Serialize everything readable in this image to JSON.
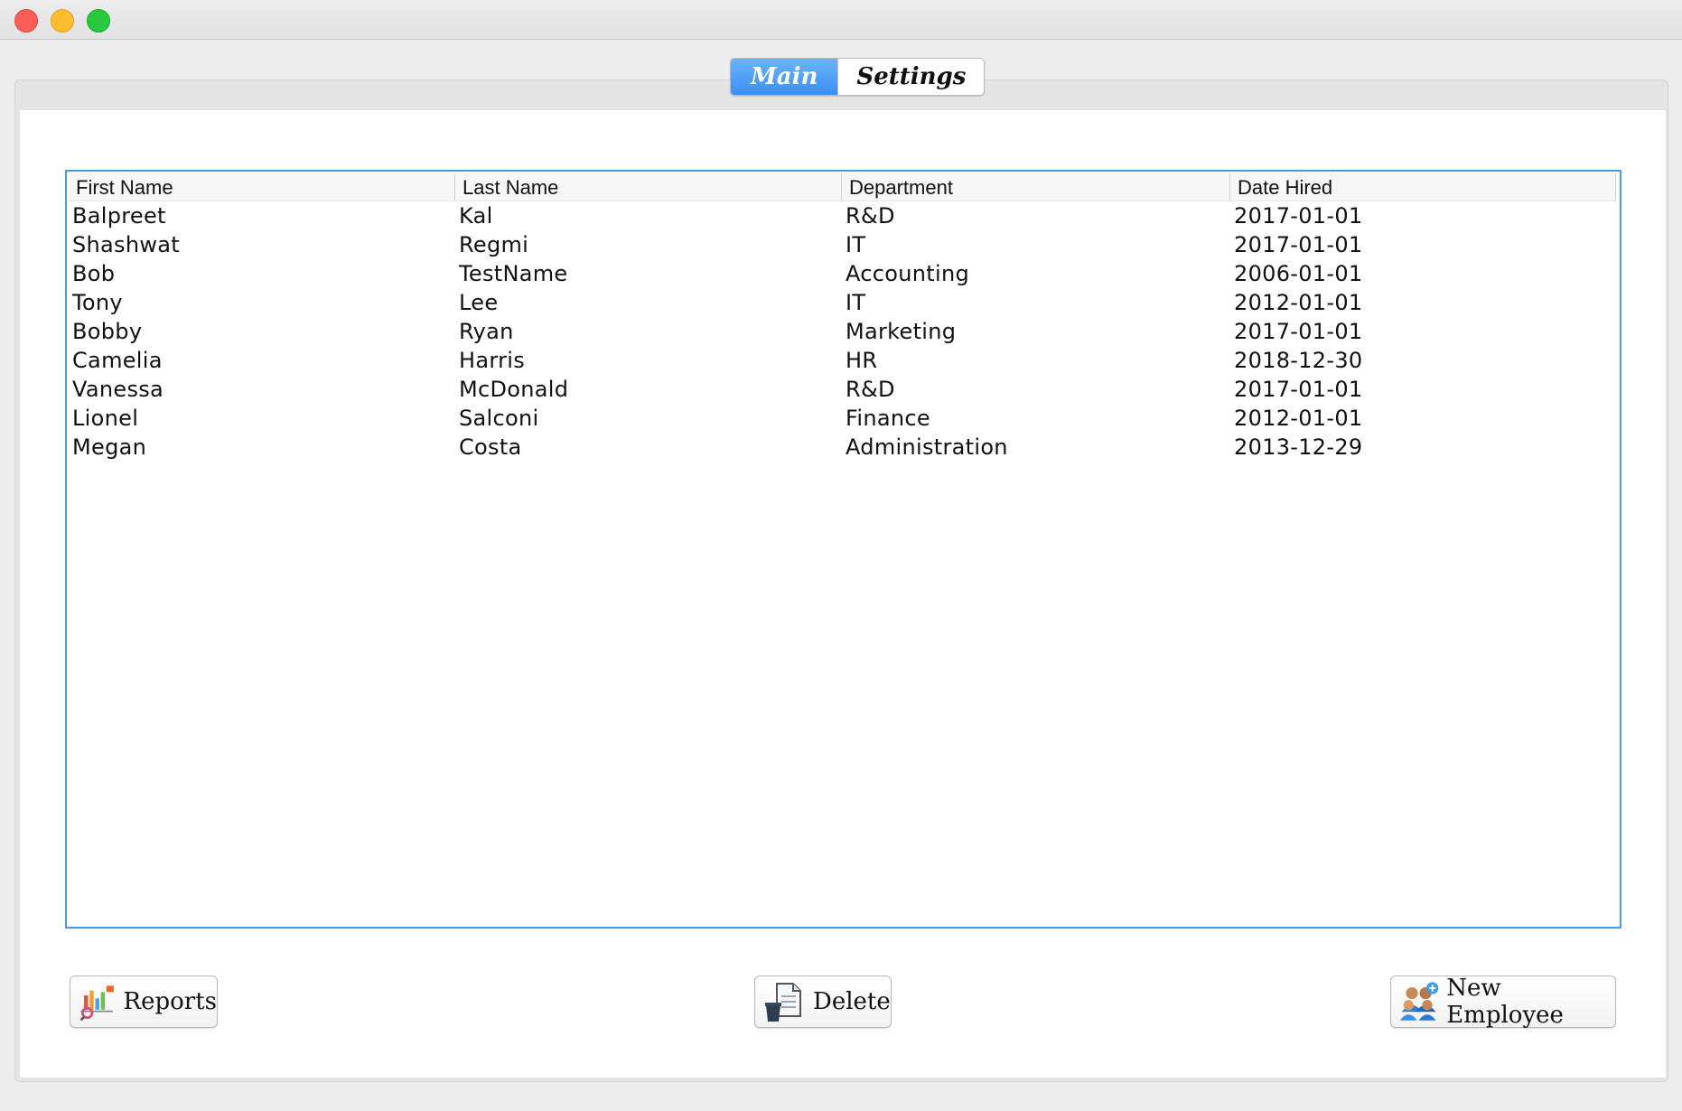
{
  "window": {
    "controls": [
      "close",
      "minimize",
      "zoom"
    ]
  },
  "tabs": [
    {
      "label": "Main",
      "active": true
    },
    {
      "label": "Settings",
      "active": false
    }
  ],
  "table": {
    "columns": [
      "First Name",
      "Last Name",
      "Department",
      "Date Hired"
    ],
    "rows": [
      [
        "Balpreet",
        "Kal",
        "R&D",
        "2017-01-01"
      ],
      [
        "Shashwat",
        "Regmi",
        "IT",
        "2017-01-01"
      ],
      [
        "Bob",
        "TestName",
        "Accounting",
        "2006-01-01"
      ],
      [
        "Tony",
        "Lee",
        "IT",
        "2012-01-01"
      ],
      [
        "Bobby",
        "Ryan",
        "Marketing",
        "2017-01-01"
      ],
      [
        "Camelia",
        "Harris",
        "HR",
        "2018-12-30"
      ],
      [
        "Vanessa",
        "McDonald",
        "R&D",
        "2017-01-01"
      ],
      [
        "Lionel",
        "Salconi",
        "Finance",
        "2012-01-01"
      ],
      [
        "Megan",
        "Costa",
        "Administration",
        "2013-12-29"
      ]
    ]
  },
  "buttons": {
    "reports": {
      "label": "Reports",
      "icon": "report-chart-icon"
    },
    "delete": {
      "label": "Delete",
      "icon": "delete-document-icon"
    },
    "new_employee": {
      "label": "New Employee",
      "icon": "add-employees-icon"
    }
  },
  "colors": {
    "accent": "#4a9be6",
    "tab_active": "#3b8ff3"
  }
}
